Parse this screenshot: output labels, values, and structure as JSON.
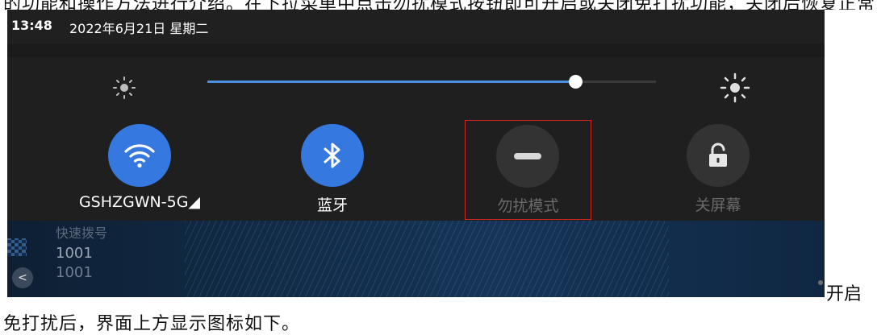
{
  "document": {
    "top_line": "的功能和操作方法进行介绍。在下拉菜单中点击勿扰模式按钮即可开启或关闭免打扰功能，关闭后恢复正常",
    "after_screenshot": "开启",
    "next_line": "免打扰后，界面上方显示图标如下。"
  },
  "status_bar": {
    "time": "13:48",
    "date": "2022年6月21日 星期二"
  },
  "brightness": {
    "level": 0.82,
    "low_icon": "brightness-low-icon",
    "high_icon": "brightness-high-icon",
    "accent": "#4a90e2"
  },
  "quick_settings": [
    {
      "id": "wifi",
      "label": "GSHZGWN-5G◢",
      "icon": "wifi-icon",
      "state": "on"
    },
    {
      "id": "bluetooth",
      "label": "蓝牙",
      "icon": "bluetooth-icon",
      "state": "on"
    },
    {
      "id": "do-not-disturb",
      "label": "勿扰模式",
      "icon": "minus-circle-icon",
      "state": "off",
      "highlighted": true
    },
    {
      "id": "screen-off",
      "label": "关屏幕",
      "icon": "lock-icon",
      "state": "off"
    }
  ],
  "background_app": {
    "title": "快速拨号",
    "line1": "1001",
    "line2": "1001",
    "back": "<"
  },
  "colors": {
    "tile_on": "#3478e0",
    "tile_off": "#333333",
    "highlight_border": "#d0261f"
  }
}
